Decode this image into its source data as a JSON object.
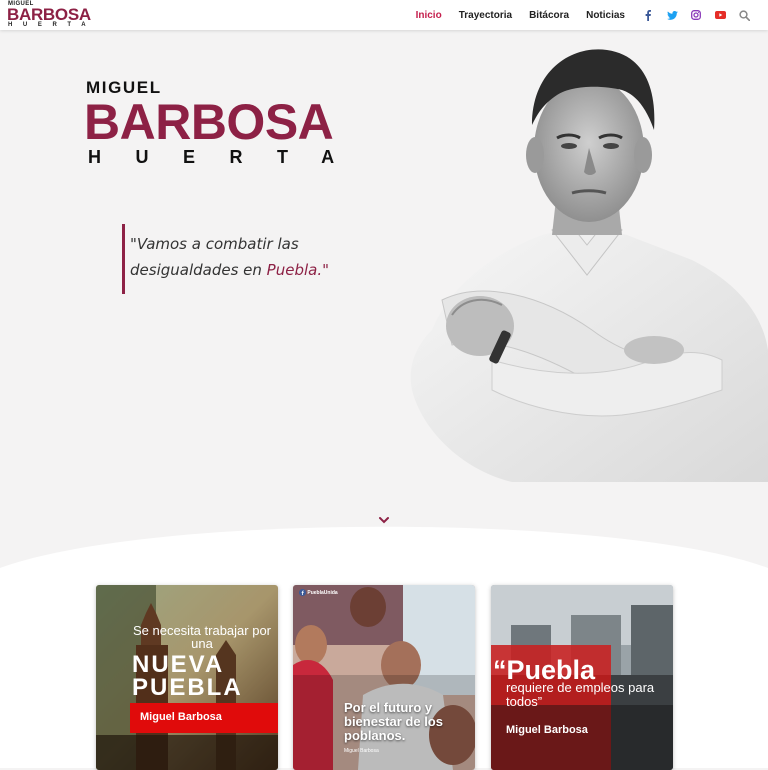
{
  "header": {
    "logo": {
      "line1": "MIGUEL",
      "line2": "BARBOSA",
      "line3": "HUERTA"
    },
    "nav": [
      {
        "label": "Inicio",
        "active": true
      },
      {
        "label": "Trayectoria",
        "active": false
      },
      {
        "label": "Bitácora",
        "active": false
      },
      {
        "label": "Noticias",
        "active": false
      }
    ],
    "social": [
      {
        "icon": "facebook-icon",
        "color": "#3b5998"
      },
      {
        "icon": "twitter-icon",
        "color": "#1da1f2"
      },
      {
        "icon": "instagram-icon",
        "color": "#8a3ab9"
      },
      {
        "icon": "youtube-icon",
        "color": "#e52d27"
      },
      {
        "icon": "search-icon",
        "color": "#888888"
      }
    ]
  },
  "hero": {
    "brand": {
      "line1": "MIGUEL",
      "line2": "BARBOSA",
      "line3": "HUERTA"
    },
    "quote": {
      "text_before": "\"Vamos a combatir las desigualdades en ",
      "highlight": "Puebla.\""
    },
    "scroll_icon": "chevron-down-icon"
  },
  "cards": [
    {
      "line1": "Se necesita trabajar por una",
      "line2": "NUEVA PUEBLA",
      "signature": "Miguel Barbosa"
    },
    {
      "page_tag": "PueblaUnida",
      "headline": "Por el futuro y bienestar de los poblanos.",
      "signature": "Miguel Barbosa"
    },
    {
      "headline": "“Puebla",
      "subline": "requiere de empleos para todos”",
      "signature": "Miguel Barbosa"
    }
  ],
  "colors": {
    "brand": "#8d2145",
    "accent": "#c51f4d",
    "red": "#e00b0b"
  }
}
